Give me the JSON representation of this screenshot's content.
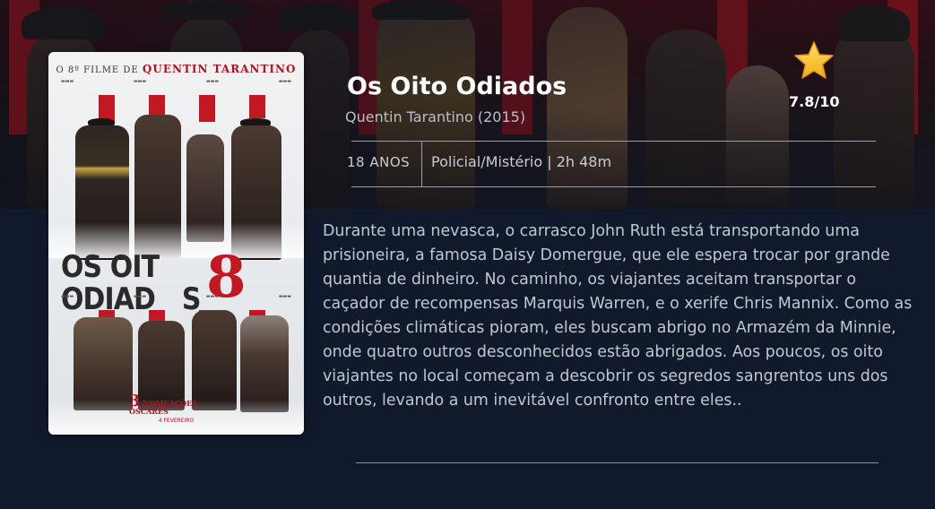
{
  "movie": {
    "title": "Os Oito Odiados",
    "director_year": "Quentin Tarantino (2015)",
    "age_rating": "18 ANOS",
    "genre_duration": "Policial/Mistério | 2h 48m",
    "rating": "7.8/10",
    "synopsis": "Durante uma nevasca, o carrasco John Ruth está transportando uma prisioneira, a famosa Daisy Domergue, que ele espera trocar por grande quantia de dinheiro. No caminho, os viajantes aceitam transportar o caçador de recompensas Marquis Warren, e o xerife Chris Mannix. Como as condições climáticas pioram, eles buscam abrigo no Armazém da Minnie, onde quatro outros desconhecidos estão abrigados. Aos poucos, os oito viajantes no local começam a descobrir os segredos sangrentos uns dos outros, levando a um inevitável confronto entre eles.."
  },
  "poster": {
    "tagline_prefix": "O 8º FILME DE",
    "tagline_director": "QUENTIN TARANTINO",
    "title_line1": "OS OIT",
    "title_line2": "ODIAD",
    "title_line2_end": "S",
    "title_number": "8",
    "badge_number": "3",
    "badge_text_1": "NOMEAÇÕES",
    "badge_text_2": "OSCARES",
    "release_text": "4 FEVEREIRO"
  },
  "icons": {
    "rating": "star-icon"
  },
  "colors": {
    "background": "#111a2c",
    "star": "#f7c325",
    "poster_red": "#c21821"
  }
}
